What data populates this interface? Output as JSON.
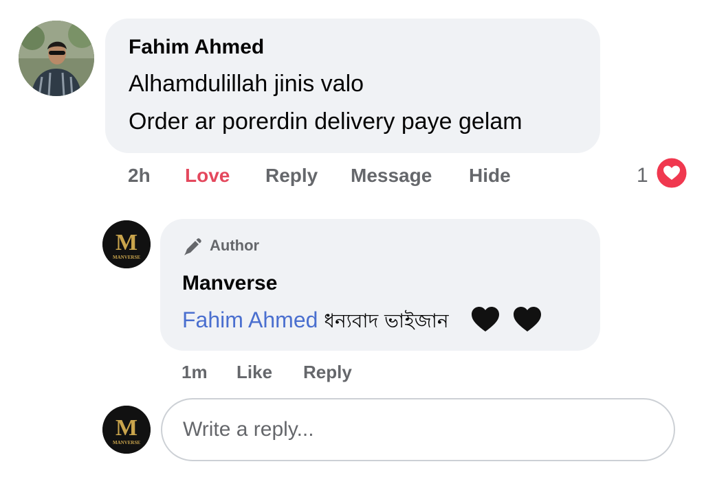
{
  "comment": {
    "author": "Fahim Ahmed",
    "lines": [
      "Alhamdulillah jinis valo",
      "Order ar porerdin delivery paye gelam"
    ],
    "time": "2h",
    "actions": {
      "love": "Love",
      "reply": "Reply",
      "message": "Message",
      "hide": "Hide"
    },
    "reaction_count": "1",
    "reaction_icon": "heart-reaction-icon"
  },
  "reply": {
    "badge": "Author",
    "badge_icon": "pen-icon",
    "author": "Manverse",
    "mention": "Fahim Ahmed",
    "text": "ধন্যবাদ ভাইজান",
    "emojis": [
      "black-heart",
      "black-heart"
    ],
    "time": "1m",
    "actions": {
      "like": "Like",
      "reply": "Reply"
    }
  },
  "brand_logo": {
    "letter": "M",
    "name": "MANVERSE"
  },
  "composer": {
    "placeholder": "Write a reply...",
    "value": ""
  },
  "colors": {
    "bubble": "#f0f2f5",
    "love": "#e4485d",
    "mention": "#4a6fcf",
    "secondary_text": "#65676b",
    "gold": "#c9a44c"
  }
}
